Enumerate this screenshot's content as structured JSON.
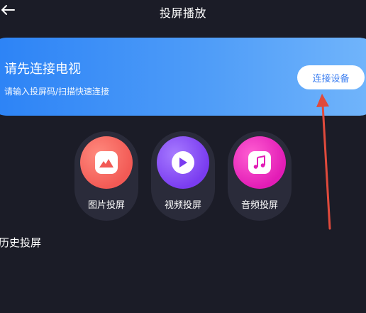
{
  "header": {
    "title": "投屏播放",
    "back_icon": "arrow-left-icon"
  },
  "banner": {
    "title": "请先连接电视",
    "subtitle": "请输入投屏码/扫描快速连接",
    "connect_label": "连接设备"
  },
  "cast_options": [
    {
      "label": "图片投屏",
      "icon": "image-icon",
      "color": "#f25a55"
    },
    {
      "label": "视频投屏",
      "icon": "play-icon",
      "color": "#7a3cf0"
    },
    {
      "label": "音频投屏",
      "icon": "music-note-icon",
      "color": "#e21cb6"
    }
  ],
  "history": {
    "title": "历史投屏"
  },
  "colors": {
    "background": "#1b1c27",
    "banner_start": "#2b82f6",
    "banner_end": "#73b6fb",
    "accent_blue": "#3a7df0",
    "annotation_red": "#e04a3c"
  }
}
